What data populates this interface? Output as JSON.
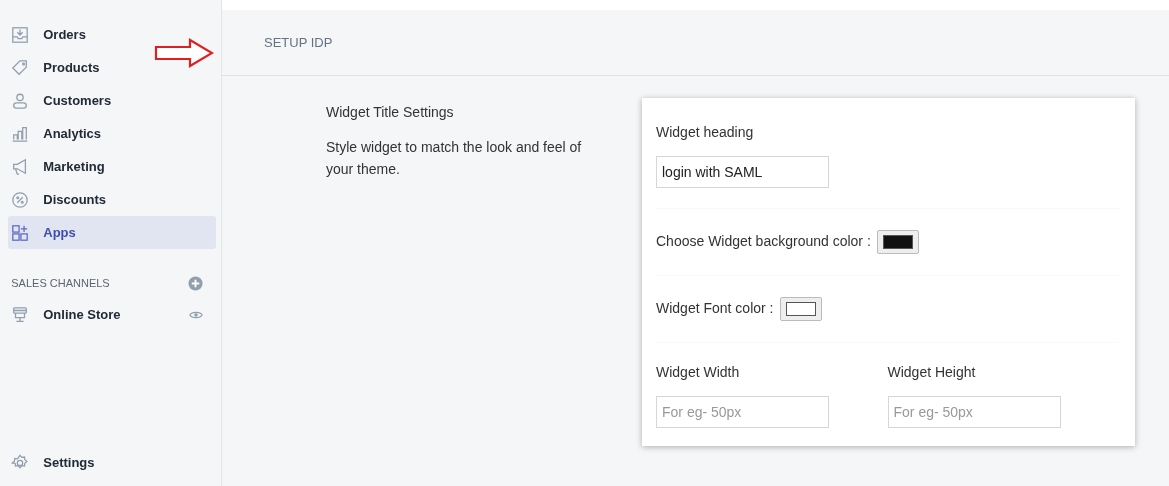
{
  "sidebar": {
    "items": [
      {
        "label": "Orders",
        "selected": false
      },
      {
        "label": "Products",
        "selected": false
      },
      {
        "label": "Customers",
        "selected": false
      },
      {
        "label": "Analytics",
        "selected": false
      },
      {
        "label": "Marketing",
        "selected": false
      },
      {
        "label": "Discounts",
        "selected": false
      },
      {
        "label": "Apps",
        "selected": true
      }
    ],
    "sales_channels": {
      "heading": "SALES CHANNELS",
      "items": [
        {
          "label": "Online Store"
        }
      ]
    },
    "settings": {
      "label": "Settings"
    }
  },
  "header": {
    "title": "SETUP IDP"
  },
  "section": {
    "title": "Widget Title Settings",
    "description": "Style widget to match the look and feel of your theme."
  },
  "form": {
    "heading": {
      "label": "Widget heading",
      "value": "login with SAML"
    },
    "background_color": {
      "label": "Choose Widget background color :",
      "color": "#111111"
    },
    "font_color": {
      "label": "Widget Font color :",
      "color": "#ffffff"
    },
    "size_fields": [
      {
        "label": "Widget Width",
        "placeholder": "For eg- 50px"
      },
      {
        "label": "Widget Height",
        "placeholder": "For eg- 50px"
      }
    ]
  }
}
